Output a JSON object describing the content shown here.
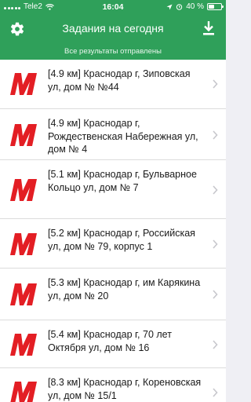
{
  "status_bar": {
    "carrier": "Tele2",
    "time": "16:04",
    "battery_percent": "40 %"
  },
  "header": {
    "title": "Задания на сегодня",
    "subtitle": "Все результаты отправлены",
    "background_color": "#2fa05a"
  },
  "icons": {
    "settings": "gear-icon",
    "download": "download-icon",
    "store_logo": "magnit-m-logo-icon",
    "chevron": "chevron-right-icon"
  },
  "brand_color": "#e31e24",
  "tasks": [
    {
      "text": "[4.9 км]  Краснодар г, Зиповская ул,  дом № №44"
    },
    {
      "text": "[4.9 км]  Краснодар г, Рождественская Набережная ул,  дом № 4"
    },
    {
      "text": "[5.1 км]  Краснодар г, Бульварное Кольцо ул,  дом № 7"
    },
    {
      "text": "[5.2 км]  Краснодар г, Российская ул,  дом № 79, корпус 1"
    },
    {
      "text": "[5.3 км]  Краснодар г,  им Карякина ул,  дом № 20"
    },
    {
      "text": "[5.4 км]  Краснодар г,  70 лет Октября ул,  дом № 16"
    },
    {
      "text": "[8.3 км]  Краснодар г, Кореновская ул,  дом № 15/1"
    }
  ]
}
